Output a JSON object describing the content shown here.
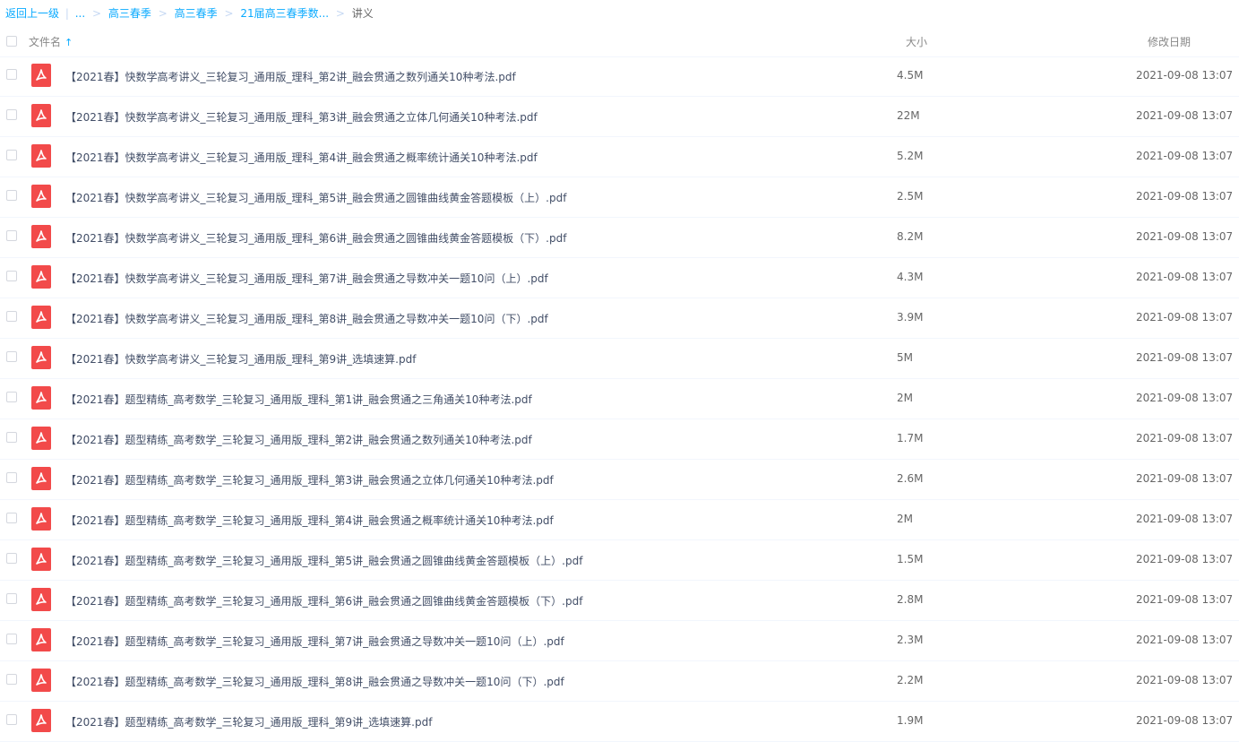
{
  "breadcrumb": {
    "back": "返回上一级",
    "divider": "|",
    "ellipsis": "...",
    "items": [
      "高三春季",
      "高三春季",
      "21届高三春季数..."
    ],
    "current": "讲义",
    "sep": ">"
  },
  "header": {
    "name": "文件名",
    "sort_icon": "↑",
    "size": "大小",
    "date": "修改日期"
  },
  "files": [
    {
      "name": "【2021春】快数学高考讲义_三轮复习_通用版_理科_第2讲_融会贯通之数列通关10种考法.pdf",
      "size": "4.5M",
      "date": "2021-09-08 13:07"
    },
    {
      "name": "【2021春】快数学高考讲义_三轮复习_通用版_理科_第3讲_融会贯通之立体几何通关10种考法.pdf",
      "size": "22M",
      "date": "2021-09-08 13:07"
    },
    {
      "name": "【2021春】快数学高考讲义_三轮复习_通用版_理科_第4讲_融会贯通之概率统计通关10种考法.pdf",
      "size": "5.2M",
      "date": "2021-09-08 13:07"
    },
    {
      "name": "【2021春】快数学高考讲义_三轮复习_通用版_理科_第5讲_融会贯通之圆锥曲线黄金答题模板（上）.pdf",
      "size": "2.5M",
      "date": "2021-09-08 13:07"
    },
    {
      "name": "【2021春】快数学高考讲义_三轮复习_通用版_理科_第6讲_融会贯通之圆锥曲线黄金答题模板（下）.pdf",
      "size": "8.2M",
      "date": "2021-09-08 13:07"
    },
    {
      "name": "【2021春】快数学高考讲义_三轮复习_通用版_理科_第7讲_融会贯通之导数冲关一题10问（上）.pdf",
      "size": "4.3M",
      "date": "2021-09-08 13:07"
    },
    {
      "name": "【2021春】快数学高考讲义_三轮复习_通用版_理科_第8讲_融会贯通之导数冲关一题10问（下）.pdf",
      "size": "3.9M",
      "date": "2021-09-08 13:07"
    },
    {
      "name": "【2021春】快数学高考讲义_三轮复习_通用版_理科_第9讲_选填速算.pdf",
      "size": "5M",
      "date": "2021-09-08 13:07"
    },
    {
      "name": "【2021春】题型精练_高考数学_三轮复习_通用版_理科_第1讲_融会贯通之三角通关10种考法.pdf",
      "size": "2M",
      "date": "2021-09-08 13:07"
    },
    {
      "name": "【2021春】题型精练_高考数学_三轮复习_通用版_理科_第2讲_融会贯通之数列通关10种考法.pdf",
      "size": "1.7M",
      "date": "2021-09-08 13:07"
    },
    {
      "name": "【2021春】题型精练_高考数学_三轮复习_通用版_理科_第3讲_融会贯通之立体几何通关10种考法.pdf",
      "size": "2.6M",
      "date": "2021-09-08 13:07"
    },
    {
      "name": "【2021春】题型精练_高考数学_三轮复习_通用版_理科_第4讲_融会贯通之概率统计通关10种考法.pdf",
      "size": "2M",
      "date": "2021-09-08 13:07"
    },
    {
      "name": "【2021春】题型精练_高考数学_三轮复习_通用版_理科_第5讲_融会贯通之圆锥曲线黄金答题模板（上）.pdf",
      "size": "1.5M",
      "date": "2021-09-08 13:07"
    },
    {
      "name": "【2021春】题型精练_高考数学_三轮复习_通用版_理科_第6讲_融会贯通之圆锥曲线黄金答题模板（下）.pdf",
      "size": "2.8M",
      "date": "2021-09-08 13:07"
    },
    {
      "name": "【2021春】题型精练_高考数学_三轮复习_通用版_理科_第7讲_融会贯通之导数冲关一题10问（上）.pdf",
      "size": "2.3M",
      "date": "2021-09-08 13:07"
    },
    {
      "name": "【2021春】题型精练_高考数学_三轮复习_通用版_理科_第8讲_融会贯通之导数冲关一题10问（下）.pdf",
      "size": "2.2M",
      "date": "2021-09-08 13:07"
    },
    {
      "name": "【2021春】题型精练_高考数学_三轮复习_通用版_理科_第9讲_选填速算.pdf",
      "size": "1.9M",
      "date": "2021-09-08 13:07"
    }
  ],
  "icons": {
    "file": "pdf-icon",
    "checkbox": "checkbox-icon",
    "sort": "sort-asc-icon"
  },
  "colors": {
    "link": "#09aaff",
    "pdf_icon": "#f24a4a",
    "text": "#424e67"
  }
}
